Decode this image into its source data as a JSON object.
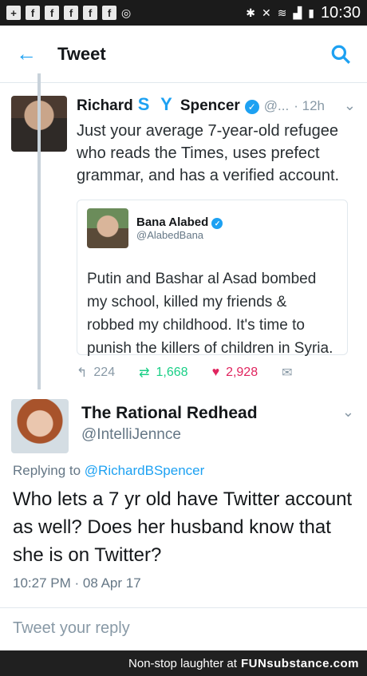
{
  "statusbar": {
    "icons": [
      "plus-box",
      "f-box",
      "f-box",
      "f-box",
      "f-box",
      "f-box",
      "instagram-icon",
      "bluetooth-icon",
      "mute-icon",
      "wifi-icon",
      "4g-signal-icon",
      "battery-icon"
    ],
    "time": "10:30"
  },
  "appbar": {
    "back_icon": "arrow-left-icon",
    "title": "Tweet",
    "search_icon": "search-icon"
  },
  "tweet": {
    "name_first": "Richard",
    "name_mid": "S Y",
    "name_last": "Spencer",
    "handle": "@...",
    "time": "· 12h",
    "text": "Just your average 7-year-old refugee who reads the Times, uses prefect grammar, and has a verified account.",
    "quote": {
      "name": "Bana Alabed",
      "handle": "@AlabedBana",
      "text": "Putin and Bashar al Asad bombed my school, killed my friends & robbed my childhood. It's time to punish the killers of children in Syria."
    },
    "actions": {
      "reply": "224",
      "retweets": "1,668",
      "likes": "2,928"
    }
  },
  "reply": {
    "name": "The Rational Redhead",
    "handle": "@IntelliJennce",
    "replying_prefix": "Replying to ",
    "replying_to": "@RichardBSpencer",
    "text": "Who lets a 7 yr old have Twitter account as well? Does her husband know that she is on Twitter?",
    "meta": "10:27 PM · 08 Apr 17"
  },
  "compose": {
    "placeholder": "Tweet your reply"
  },
  "footer": {
    "text": "Non-stop laughter at",
    "site": "FUNsubstance.com"
  },
  "colors": {
    "accent": "#1da1f2",
    "retweet": "#19cf86",
    "like": "#e0245e"
  }
}
